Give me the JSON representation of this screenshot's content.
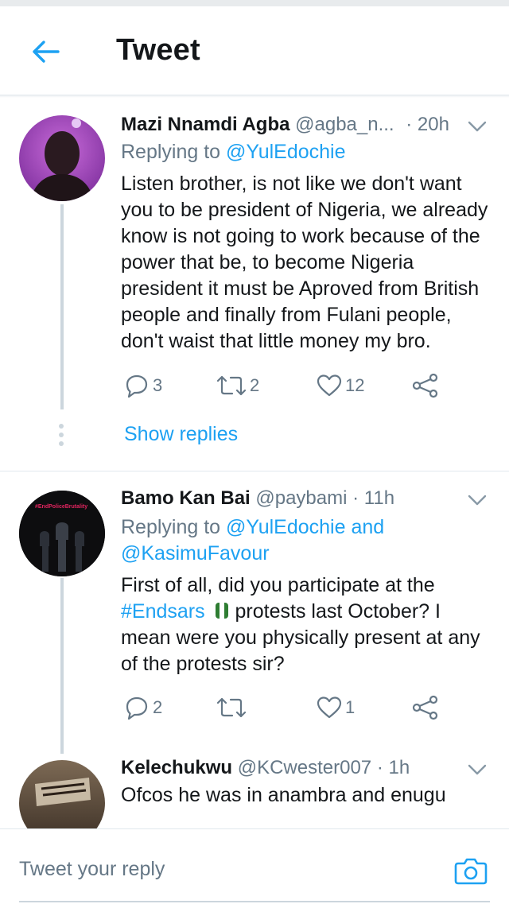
{
  "header": {
    "title": "Tweet",
    "back_icon": "arrow-left-icon"
  },
  "colors": {
    "accent": "#1da1f2",
    "text_primary": "#14171a",
    "text_secondary": "#657786",
    "divider": "#e1e8ed"
  },
  "tweets": [
    {
      "name": "Mazi Nnamdi Agba",
      "handle": "@agba_n...",
      "time": "· 20h",
      "replying_prefix": "Replying to ",
      "replying_to": "@YulEdochie",
      "text": "Listen brother, is not like we don't want you to be president of Nigeria, we already know is not going to work because of the power that be, to become Nigeria president it must be Aproved from British people and finally from Fulani people, don't waist that little money my bro.",
      "replies": "3",
      "retweets": "2",
      "likes": "12",
      "show_replies": "Show replies"
    },
    {
      "name": "Bamo Kan Bai",
      "handle": "@paybami",
      "time": "· 11h",
      "replying_prefix": "Replying to ",
      "replying_to": "@YulEdochie and",
      "replying_to_2": "@KasimuFavour",
      "text_1": "First of all, did you participate at the",
      "hashtag": "#Endsars",
      "text_2": " protests last October? I mean were you physically present at any of the protests sir?",
      "avatar_text": "#EndPoliceBrutality",
      "replies": "2",
      "retweets": "",
      "likes": "1"
    },
    {
      "name": "Kelechukwu",
      "handle": "@KCwester007",
      "time": "· 1h",
      "text": "Ofcos he was in anambra and enugu"
    }
  ],
  "reply_bar": {
    "placeholder": "Tweet your reply",
    "camera_icon": "camera-icon"
  }
}
